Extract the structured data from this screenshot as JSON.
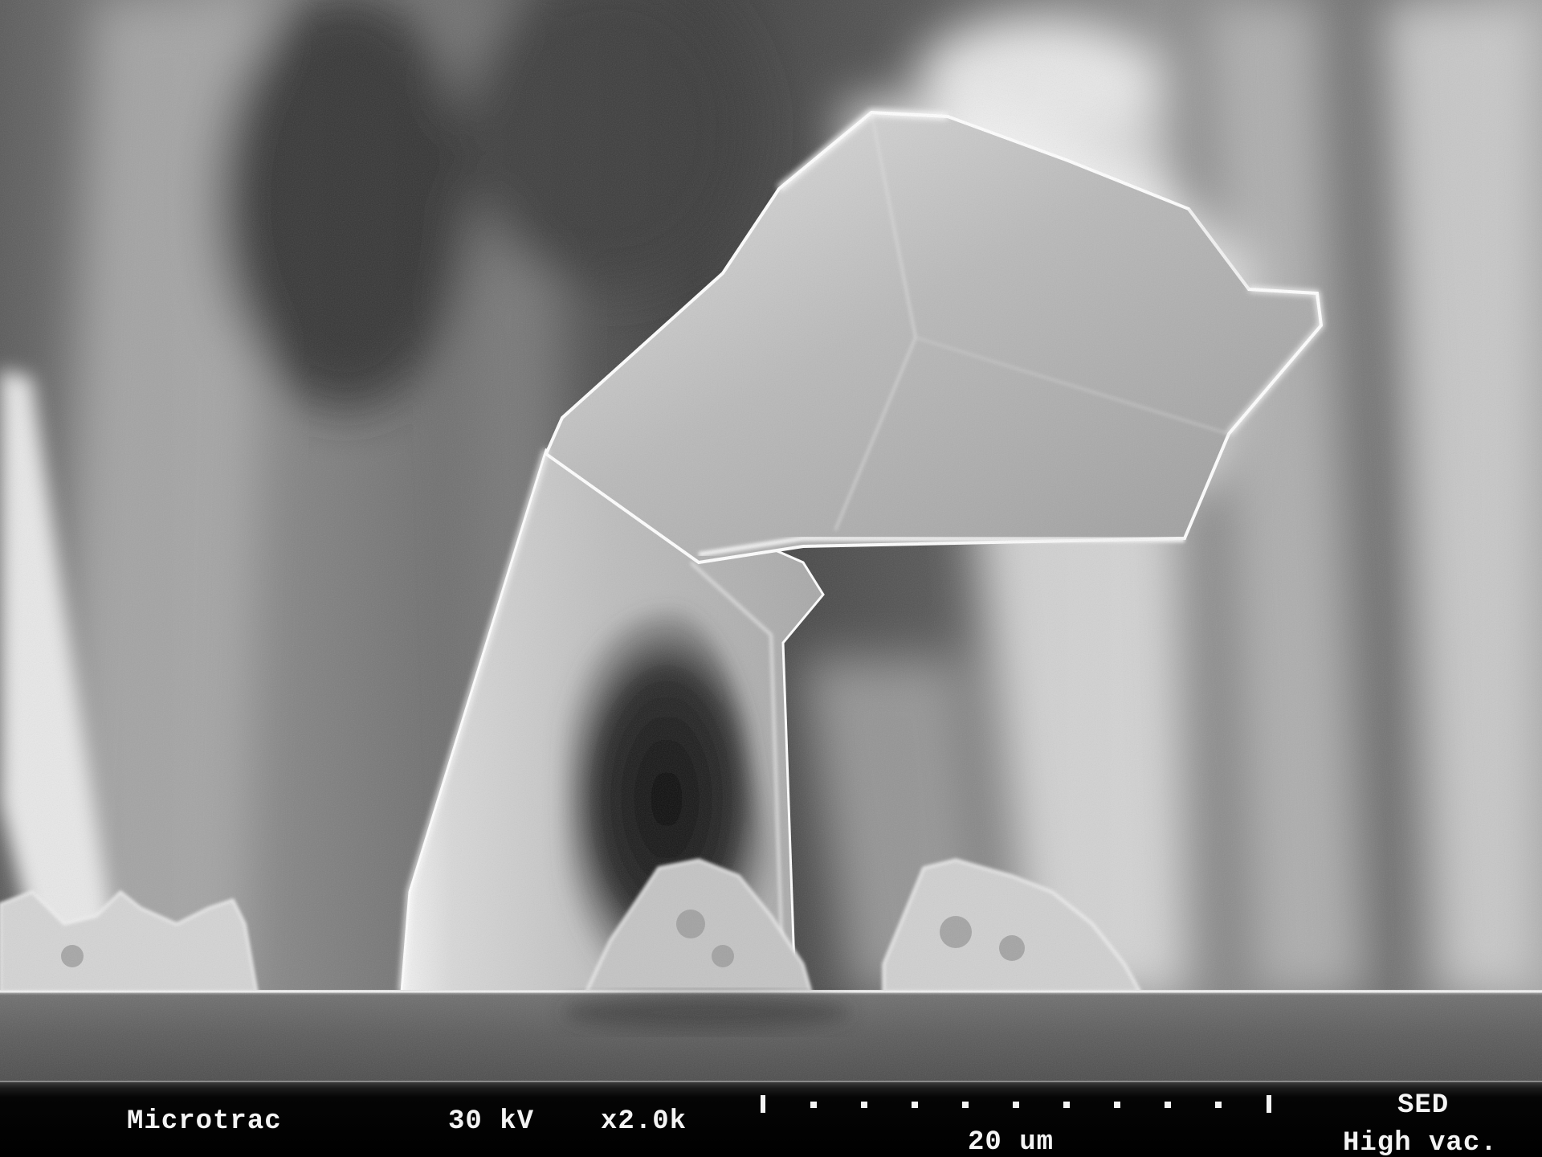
{
  "image": {
    "subject": "Scanning electron micrograph of a bent crystal fiber standing on a substrate with small particles",
    "palette": {
      "background": "#6e6e6e",
      "crystal": "#c8c8c8",
      "highlight": "#f5f5f5",
      "shadow": "#141414",
      "substrate": "#585858",
      "bar": "#000000",
      "text": "#f4f4f4"
    }
  },
  "info_bar": {
    "brand": "Microtrac",
    "voltage": "30 kV",
    "magnification": "x2.0k",
    "detector": "SED",
    "vacuum": "High vac.",
    "scale_label": "20 um",
    "scale_ticks": 11
  }
}
